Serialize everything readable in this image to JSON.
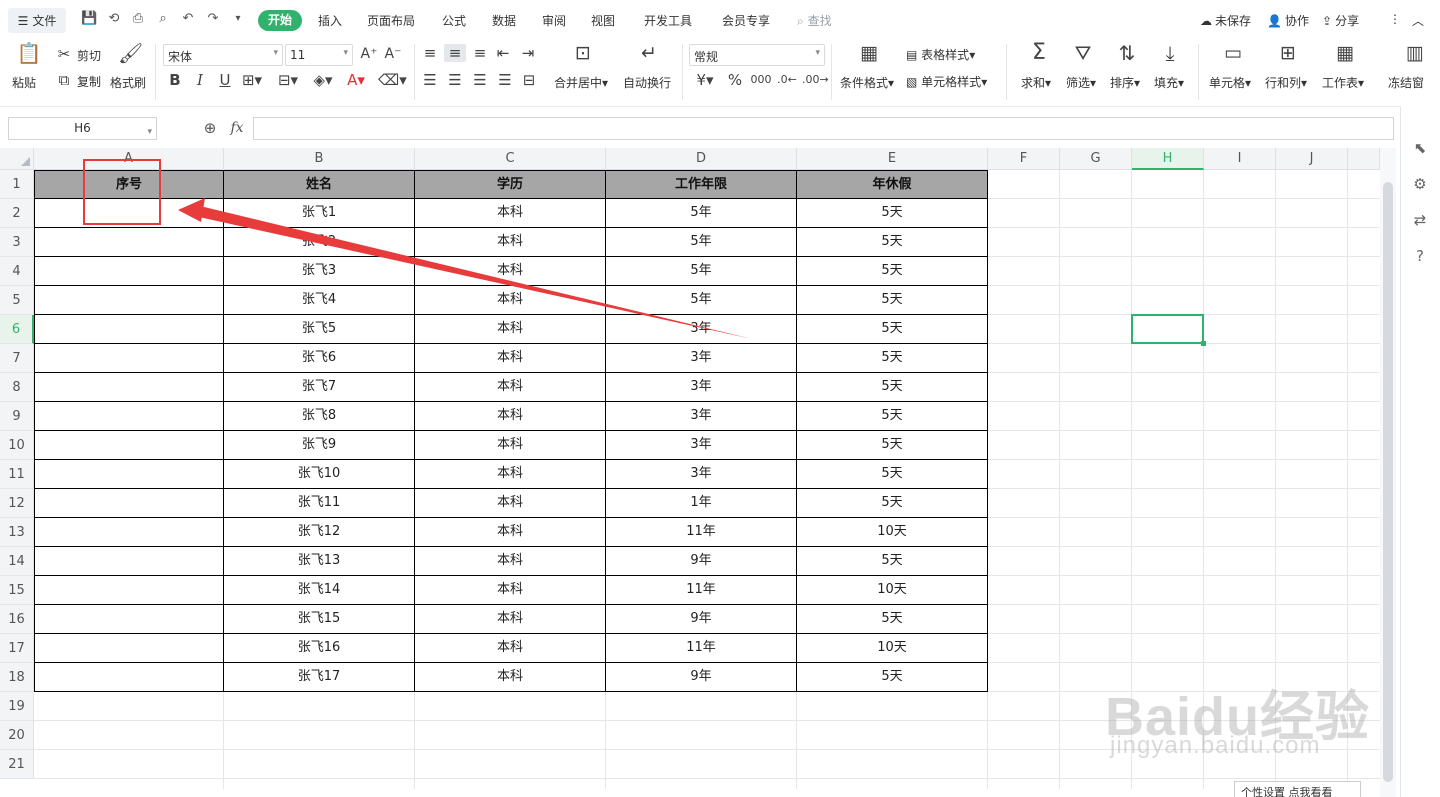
{
  "menu": {
    "file_label": "文件",
    "tabs": [
      "开始",
      "插入",
      "页面布局",
      "公式",
      "数据",
      "审阅",
      "视图",
      "开发工具",
      "会员专享"
    ],
    "search_label": "查找",
    "unsaved_label": "未保存",
    "collab_label": "协作",
    "share_label": "分享"
  },
  "ribbon": {
    "paste": "粘贴",
    "cut": "剪切",
    "copy": "复制",
    "format_painter": "格式刷",
    "font_name": "宋体",
    "font_size": "11",
    "merge_center": "合并居中",
    "wrap_text": "自动换行",
    "number_format": "常规",
    "conditional_format": "条件格式",
    "table_style": "表格样式",
    "cell_style": "单元格样式",
    "sum": "求和",
    "filter": "筛选",
    "sort": "排序",
    "fill": "填充",
    "cell": "单元格",
    "row_col": "行和列",
    "worksheet": "工作表",
    "freeze": "冻结窗"
  },
  "formula_bar": {
    "name_box": "H6",
    "fx": "fx",
    "formula": ""
  },
  "columns": [
    "A",
    "B",
    "C",
    "D",
    "E",
    "F",
    "G",
    "H",
    "I",
    "J"
  ],
  "rows": [
    "1",
    "2",
    "3",
    "4",
    "5",
    "6",
    "7",
    "8",
    "9",
    "10",
    "11",
    "12",
    "13",
    "14",
    "15",
    "16",
    "17",
    "18",
    "19",
    "20",
    "21"
  ],
  "selected_cell": "H6",
  "table": {
    "headers": [
      "序号",
      "姓名",
      "学历",
      "工作年限",
      "年休假"
    ],
    "rows": [
      [
        "",
        "张飞1",
        "本科",
        "5年",
        "5天"
      ],
      [
        "",
        "张飞2",
        "本科",
        "5年",
        "5天"
      ],
      [
        "",
        "张飞3",
        "本科",
        "5年",
        "5天"
      ],
      [
        "",
        "张飞4",
        "本科",
        "5年",
        "5天"
      ],
      [
        "",
        "张飞5",
        "本科",
        "3年",
        "5天"
      ],
      [
        "",
        "张飞6",
        "本科",
        "3年",
        "5天"
      ],
      [
        "",
        "张飞7",
        "本科",
        "3年",
        "5天"
      ],
      [
        "",
        "张飞8",
        "本科",
        "3年",
        "5天"
      ],
      [
        "",
        "张飞9",
        "本科",
        "3年",
        "5天"
      ],
      [
        "",
        "张飞10",
        "本科",
        "3年",
        "5天"
      ],
      [
        "",
        "张飞11",
        "本科",
        "1年",
        "5天"
      ],
      [
        "",
        "张飞12",
        "本科",
        "11年",
        "10天"
      ],
      [
        "",
        "张飞13",
        "本科",
        "9年",
        "5天"
      ],
      [
        "",
        "张飞14",
        "本科",
        "11年",
        "10天"
      ],
      [
        "",
        "张飞15",
        "本科",
        "9年",
        "5天"
      ],
      [
        "",
        "张飞16",
        "本科",
        "11年",
        "10天"
      ],
      [
        "",
        "张飞17",
        "本科",
        "9年",
        "5天"
      ]
    ]
  },
  "bottom_tip": "个性设置  点我看看",
  "watermark": {
    "line1": "Baidu经验",
    "line2": "jingyan.baidu.com"
  },
  "colors": {
    "accent": "#2fb36c",
    "header_fill": "#a6a6a6",
    "annotation": "#e83b3b"
  }
}
